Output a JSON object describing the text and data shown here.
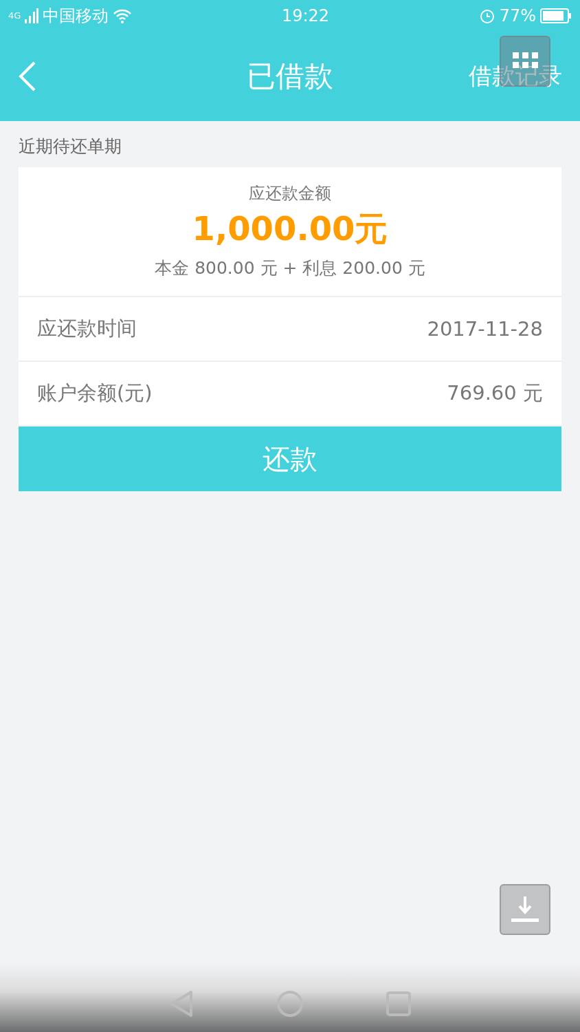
{
  "status_bar": {
    "network": "4G",
    "carrier": "中国移动",
    "time": "19:22",
    "battery": "77%"
  },
  "header": {
    "title": "已借款",
    "action": "借款记录"
  },
  "section_title": "近期待还单期",
  "summary": {
    "label": "应还款金额",
    "amount": "1,000.00元",
    "breakdown": "本金 800.00 元 + 利息 200.00 元"
  },
  "rows": [
    {
      "label": "应还款时间",
      "value": "2017-11-28"
    },
    {
      "label": "账户余额(元)",
      "value": "769.60 元"
    }
  ],
  "repay_button": "还款"
}
